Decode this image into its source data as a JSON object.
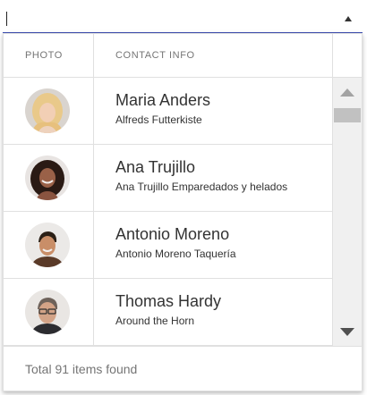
{
  "combobox": {
    "value": "",
    "arrow_icon": "triangle-up-icon"
  },
  "grid": {
    "columns": [
      "PHOTO",
      "CONTACT INFO"
    ],
    "rows": [
      {
        "name": "Maria Anders",
        "company": "Alfreds Futterkiste",
        "avatar": "blonde-woman-avatar"
      },
      {
        "name": "Ana Trujillo",
        "company": "Ana Trujillo Emparedados y helados",
        "avatar": "dark-haired-woman-avatar"
      },
      {
        "name": "Antonio Moreno",
        "company": "Antonio Moreno Taquería",
        "avatar": "man-avatar"
      },
      {
        "name": "Thomas Hardy",
        "company": "Around the Horn",
        "avatar": "man-with-glasses-avatar"
      }
    ]
  },
  "footer": {
    "text": "Total 91 items found"
  },
  "scrollbar": {
    "up_icon": "scroll-up-arrow-icon",
    "down_icon": "scroll-down-arrow-icon"
  }
}
